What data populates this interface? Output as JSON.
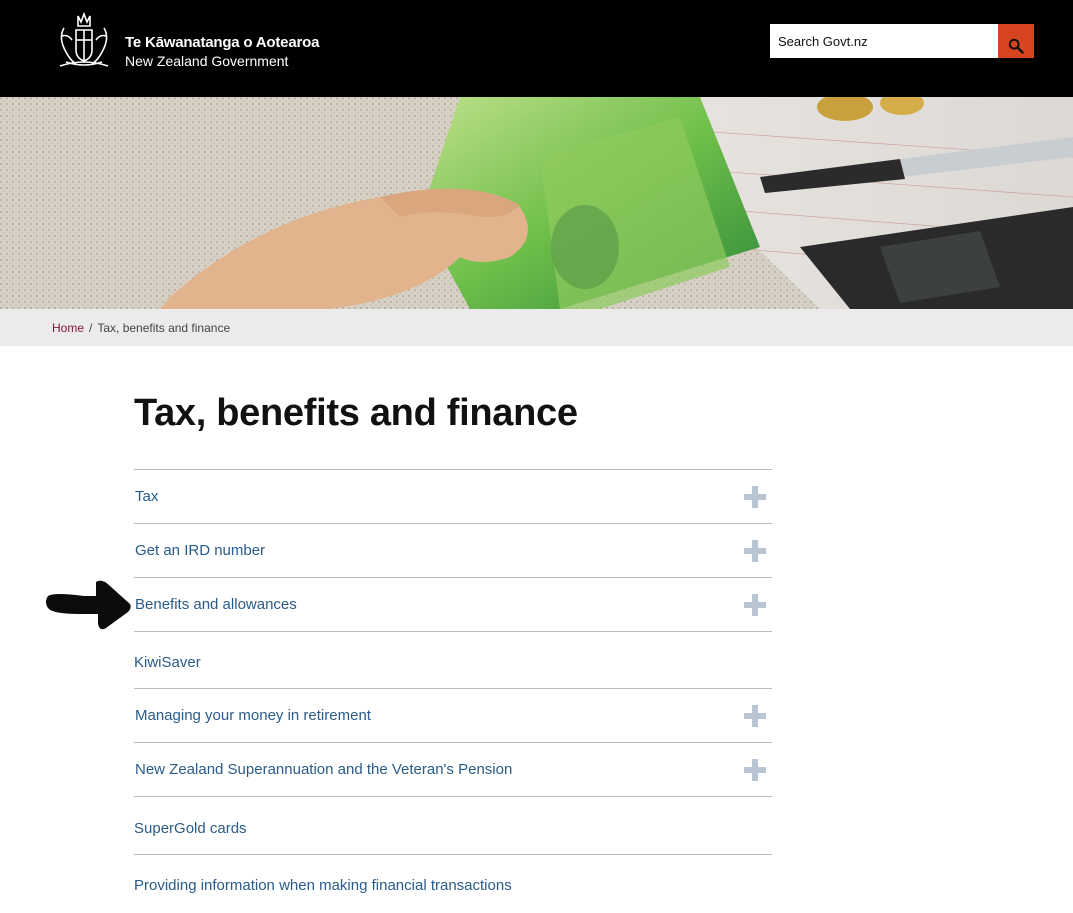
{
  "header": {
    "logo_line1": "Te Kāwanatanga o Aotearoa",
    "logo_line2": "New Zealand Government",
    "search_placeholder": "Search Govt.nz",
    "search_icon": "search-icon"
  },
  "breadcrumb": {
    "items": [
      {
        "label": "Home",
        "link": true
      },
      {
        "label": "Tax, benefits and finance",
        "link": false
      }
    ],
    "separator": "/"
  },
  "main": {
    "title": "Tax, benefits and finance",
    "items": [
      {
        "label": "Tax",
        "expandable": true
      },
      {
        "label": "Get an IRD number",
        "expandable": true
      },
      {
        "label": "Benefits and allowances",
        "expandable": true
      },
      {
        "label": "KiwiSaver",
        "expandable": false
      },
      {
        "label": "Managing your money in retirement",
        "expandable": true
      },
      {
        "label": "New Zealand Superannuation and the Veteran's Pension",
        "expandable": true
      },
      {
        "label": "SuperGold cards",
        "expandable": false
      },
      {
        "label": "Providing information when making financial transactions",
        "expandable": false
      }
    ]
  },
  "colors": {
    "header_bg": "#000000",
    "search_button": "#d6451f",
    "link": "#2a5b8a",
    "breadcrumb_home": "#8a1538",
    "expand_icon": "#b9c5d3"
  },
  "annotation": {
    "icon": "pointing-arrow-icon"
  }
}
